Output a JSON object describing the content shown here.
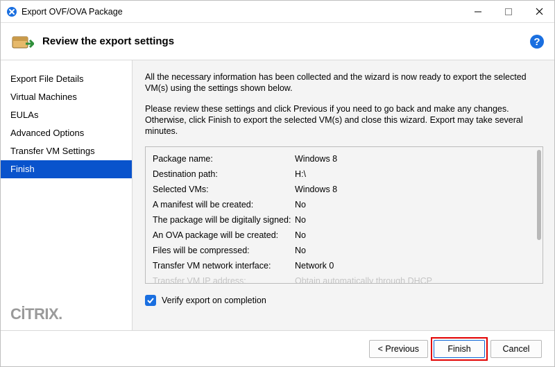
{
  "window": {
    "title": "Export OVF/OVA Package"
  },
  "header": {
    "title": "Review the export settings"
  },
  "sidebar": {
    "items": [
      {
        "label": "Export File Details"
      },
      {
        "label": "Virtual Machines"
      },
      {
        "label": "EULAs"
      },
      {
        "label": "Advanced Options"
      },
      {
        "label": "Transfer VM Settings"
      },
      {
        "label": "Finish",
        "selected": true
      }
    ],
    "brand": "CİTRIX"
  },
  "content": {
    "intro1": "All the necessary information has been collected and the wizard is now ready to export the selected VM(s) using the settings shown below.",
    "intro2": "Please review these settings and click Previous if you need to go back and make any changes. Otherwise, click Finish to export the selected VM(s) and close this wizard. Export may take several minutes.",
    "summary": [
      {
        "k": "Package name:",
        "v": "Windows 8"
      },
      {
        "k": "Destination path:",
        "v": "H:\\"
      },
      {
        "k": "Selected VMs:",
        "v": "Windows 8"
      },
      {
        "k": "A manifest will be created:",
        "v": "No"
      },
      {
        "k": "The package will be digitally signed:",
        "v": "No"
      },
      {
        "k": "An OVA package will be created:",
        "v": "No"
      },
      {
        "k": "Files will be compressed:",
        "v": "No"
      },
      {
        "k": "Transfer VM network interface:",
        "v": "Network 0"
      },
      {
        "k": "Transfer VM IP address:",
        "v": "Obtain automatically through DHCP"
      }
    ],
    "verify_label": "Verify export on completion",
    "verify_checked": true
  },
  "footer": {
    "previous": "< Previous",
    "finish": "Finish",
    "cancel": "Cancel"
  }
}
